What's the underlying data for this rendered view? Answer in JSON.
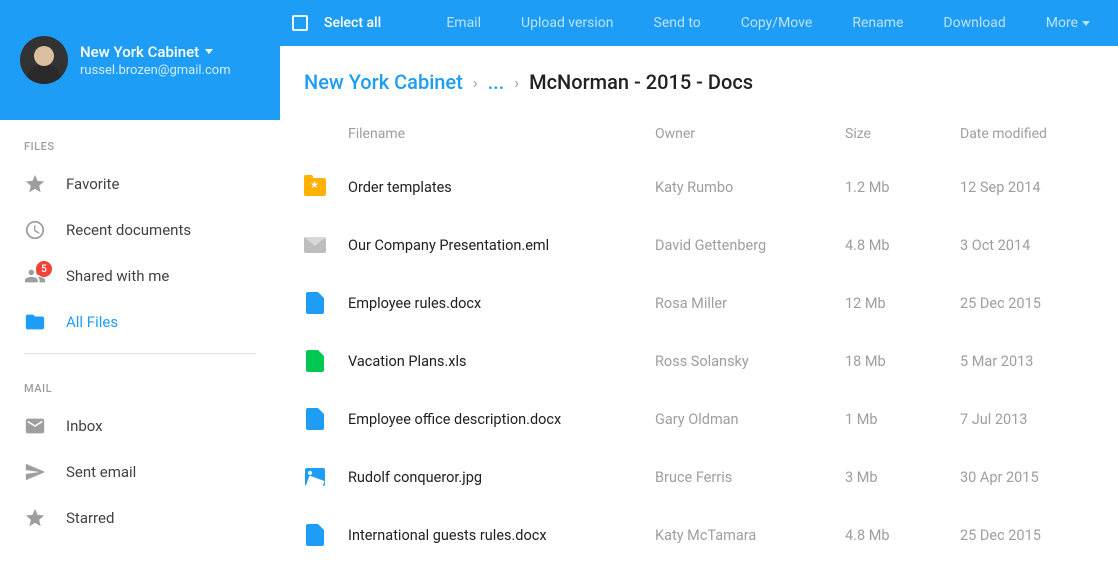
{
  "user": {
    "name": "New York Cabinet",
    "email": "russel.brozen@gmail.com"
  },
  "sidebar": {
    "sections": {
      "files": {
        "label": "FILES"
      },
      "mail": {
        "label": "MAIL"
      }
    },
    "items": {
      "favorite": {
        "label": "Favorite"
      },
      "recent": {
        "label": "Recent documents"
      },
      "shared": {
        "label": "Shared with me",
        "badge": "5"
      },
      "allfiles": {
        "label": "All Files"
      },
      "inbox": {
        "label": "Inbox"
      },
      "sent": {
        "label": "Sent email"
      },
      "starred": {
        "label": "Starred"
      }
    }
  },
  "toolbar": {
    "select_all": "Select all",
    "email": "Email",
    "upload": "Upload version",
    "send_to": "Send to",
    "copy_move": "Copy/Move",
    "rename": "Rename",
    "download": "Download",
    "more": "More"
  },
  "breadcrumb": {
    "root": "New York Cabinet",
    "ellipsis": "...",
    "current": "McNorman - 2015 - Docs"
  },
  "table": {
    "headers": {
      "filename": "Filename",
      "owner": "Owner",
      "size": "Size",
      "date": "Date modified"
    },
    "rows": [
      {
        "icon": "folder-star",
        "name": "Order templates",
        "owner": "Katy Rumbo",
        "size": "1.2 Mb",
        "date": "12 Sep 2014"
      },
      {
        "icon": "mail",
        "name": "Our Company Presentation.eml",
        "owner": "David Gettenberg",
        "size": "4.8 Mb",
        "date": "3 Oct 2014"
      },
      {
        "icon": "doc-blue",
        "name": "Employee rules.docx",
        "owner": "Rosa Miller",
        "size": "12 Mb",
        "date": "25 Dec 2015"
      },
      {
        "icon": "doc-green",
        "name": "Vacation Plans.xls",
        "owner": "Ross Solansky",
        "size": "18 Mb",
        "date": "5 Mar 2013"
      },
      {
        "icon": "doc-blue",
        "name": "Employee office description.docx",
        "owner": "Gary Oldman",
        "size": "1 Mb",
        "date": "7 Jul 2013"
      },
      {
        "icon": "image",
        "name": "Rudolf conqueror.jpg",
        "owner": "Bruce Ferris",
        "size": "3 Mb",
        "date": "30 Apr 2015"
      },
      {
        "icon": "doc-blue",
        "name": "International guests rules.docx",
        "owner": "Katy McTamara",
        "size": "4.8 Mb",
        "date": "25 Dec 2015"
      }
    ]
  }
}
